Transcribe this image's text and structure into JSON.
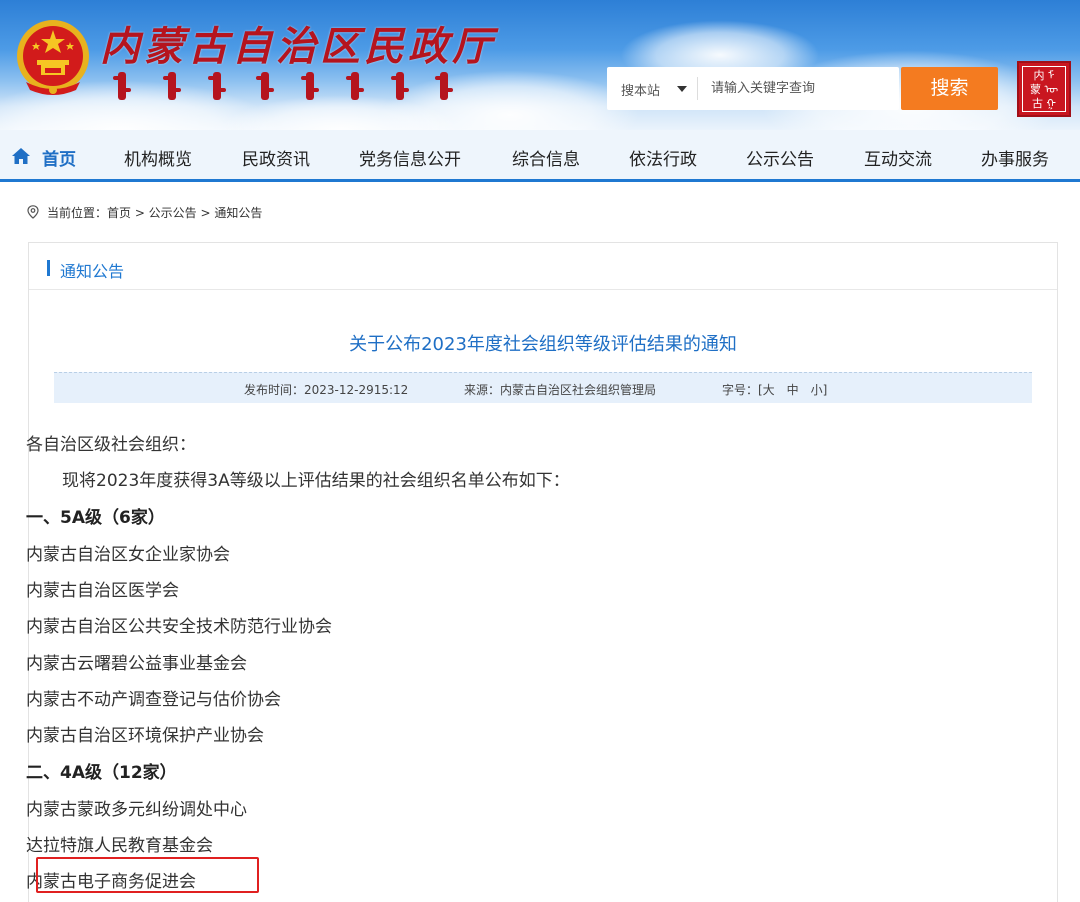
{
  "site": {
    "title_calligraphy": "内蒙古自治区民政厅",
    "seal_text": "内蒙古"
  },
  "search": {
    "scope": "搜本站",
    "placeholder": "请输入关键字查询",
    "button": "搜索"
  },
  "nav": {
    "items": [
      {
        "label": "首页",
        "active": true
      },
      {
        "label": "机构概览"
      },
      {
        "label": "民政资讯"
      },
      {
        "label": "党务信息公开"
      },
      {
        "label": "综合信息"
      },
      {
        "label": "依法行政"
      },
      {
        "label": "公示公告"
      },
      {
        "label": "互动交流"
      },
      {
        "label": "办事服务"
      }
    ]
  },
  "breadcrumb": {
    "text": "当前位置：首页 > 公示公告 > 通知公告"
  },
  "panel": {
    "title": "通知公告"
  },
  "article": {
    "title": "关于公布2023年度社会组织等级评估结果的通知",
    "publish_time": "发布时间：2023-12-2915:12",
    "source": "来源：内蒙古自治区社会组织管理局",
    "font_size": "字号：[大　中　小]",
    "paragraphs": [
      "各自治区级社会组织：",
      "现将2023年度获得3A等级以上评估结果的社会组织名单公布如下：",
      "一、5A级（6家）",
      "内蒙古自治区女企业家协会",
      "内蒙古自治区医学会",
      "内蒙古自治区公共安全技术防范行业协会",
      "内蒙古云曙碧公益事业基金会",
      "内蒙古不动产调查登记与估价协会",
      "内蒙古自治区环境保护产业协会",
      "二、4A级（12家）",
      "内蒙古蒙政多元纠纷调处中心",
      "达拉特旗人民教育基金会",
      "内蒙古电子商务促进会"
    ]
  },
  "colors": {
    "primary_blue": "#1f78d1",
    "search_orange": "#f47b20",
    "highlight_red": "#e02020",
    "title_red": "#b5141e"
  }
}
